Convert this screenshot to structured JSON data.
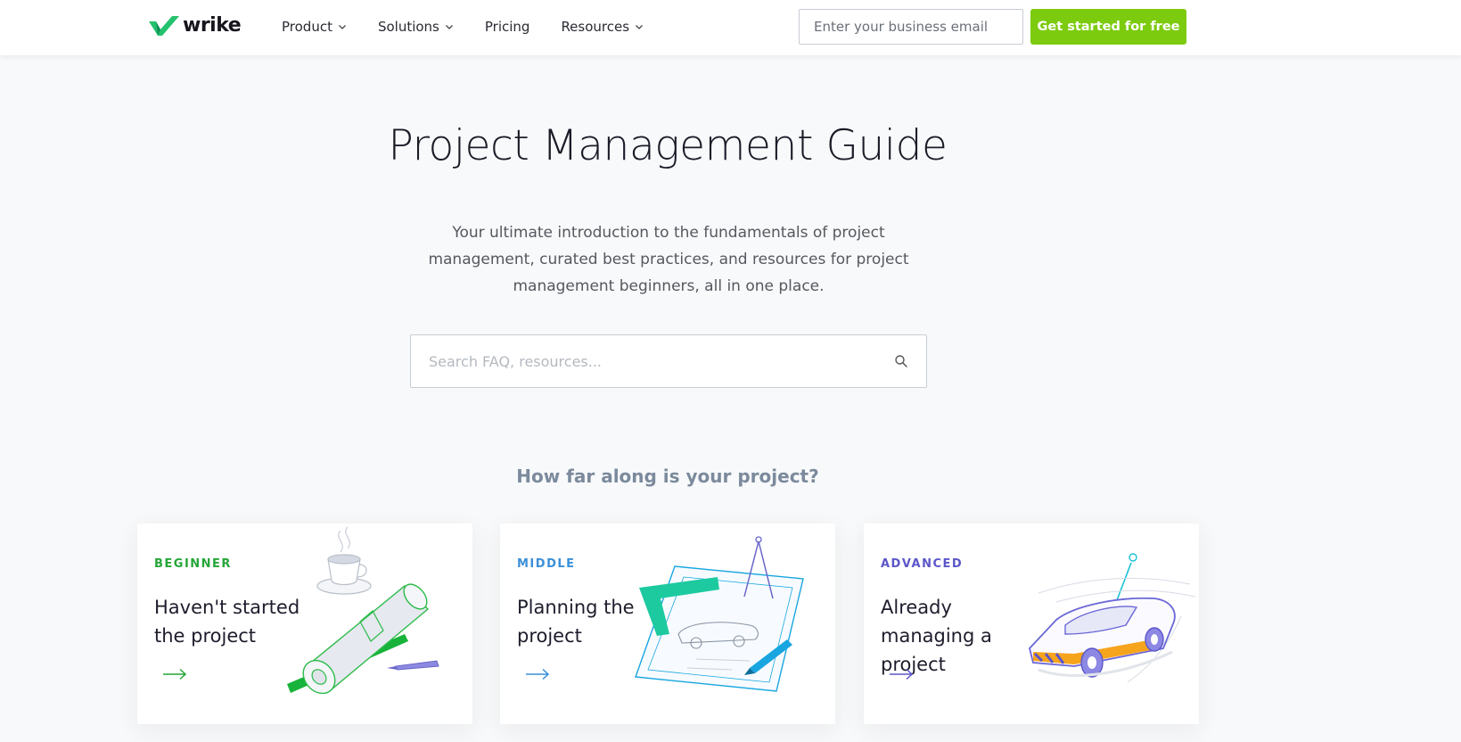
{
  "nav": {
    "logo_text": "wrike",
    "menu": [
      {
        "label": "Product",
        "has_dropdown": true
      },
      {
        "label": "Solutions",
        "has_dropdown": true
      },
      {
        "label": "Pricing",
        "has_dropdown": false
      },
      {
        "label": "Resources",
        "has_dropdown": true
      }
    ],
    "email_placeholder": "Enter your business email",
    "cta_label": "Get started for free"
  },
  "hero": {
    "title": "Project Management Guide",
    "subtitle": "Your ultimate introduction to the fundamentals of project management, curated best practices, and resources for project management beginners, all in one place.",
    "search_placeholder": "Search FAQ, resources..."
  },
  "section": {
    "question": "How far along is your project?"
  },
  "cards": [
    {
      "level": "BEGINNER",
      "title": "Haven't started the project",
      "color": "#25a638"
    },
    {
      "level": "MIDDLE",
      "title": "Planning the project",
      "color": "#3a8fd9"
    },
    {
      "level": "ADVANCED",
      "title": "Already managing a project",
      "color": "#5b56c9"
    }
  ],
  "colors": {
    "brand_green": "#7dcb0f",
    "logo_green": "#25c26e",
    "background": "#f8f9fa"
  },
  "icons": [
    "check-logo-icon",
    "chevron-down-icon",
    "search-icon",
    "arrow-right-icon"
  ]
}
